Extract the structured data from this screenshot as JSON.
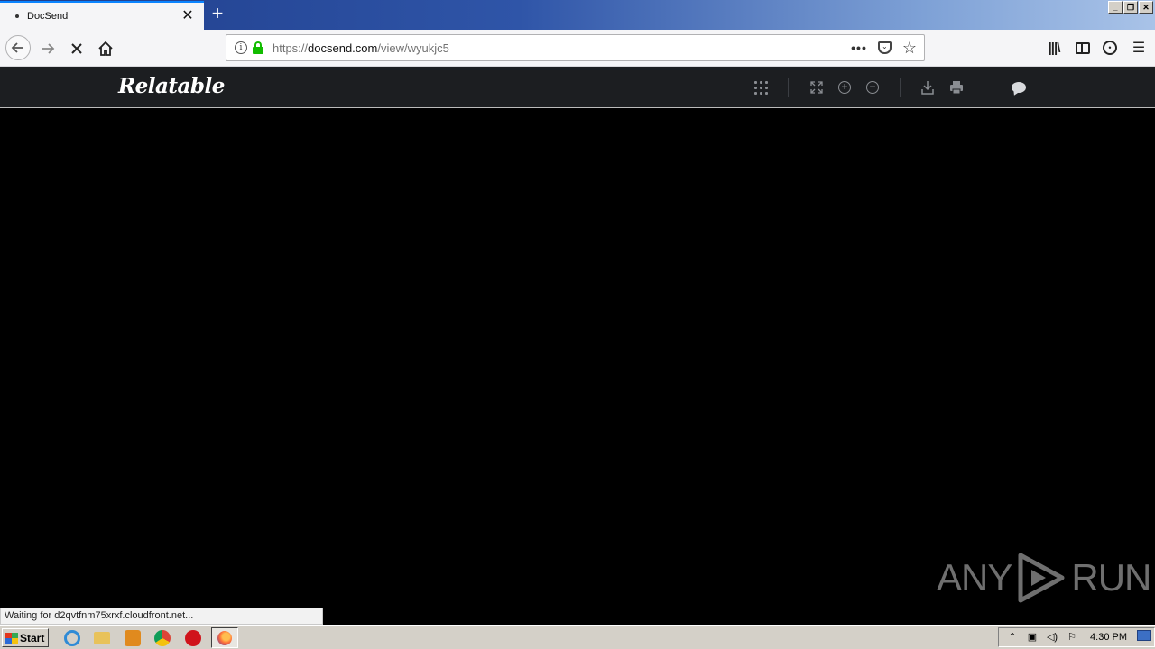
{
  "browser": {
    "tab_title": "DocSend",
    "tab_close": "✕",
    "new_tab": "+",
    "url_prefix": "https://",
    "url_host": "docsend.com",
    "url_path": "/view/wyukjc5",
    "more_actions": "•••",
    "window_controls": {
      "minimize": "_",
      "restore": "❐",
      "close": "✕"
    }
  },
  "app": {
    "logo": "Relatable"
  },
  "status_bar": "Waiting for d2qvtfnm75xrxf.cloudfront.net...",
  "watermark": {
    "left": "ANY",
    "right": "RUN"
  },
  "taskbar": {
    "start_label": "Start",
    "clock": "4:30 PM"
  },
  "icons": {
    "back": "back-arrow-icon",
    "forward": "forward-arrow-icon",
    "stop": "stop-icon",
    "home": "home-icon",
    "colors": {
      "tab_accent": "#0a84ff",
      "lock_green": "#12bc00",
      "app_header": "#1c1e21"
    }
  }
}
